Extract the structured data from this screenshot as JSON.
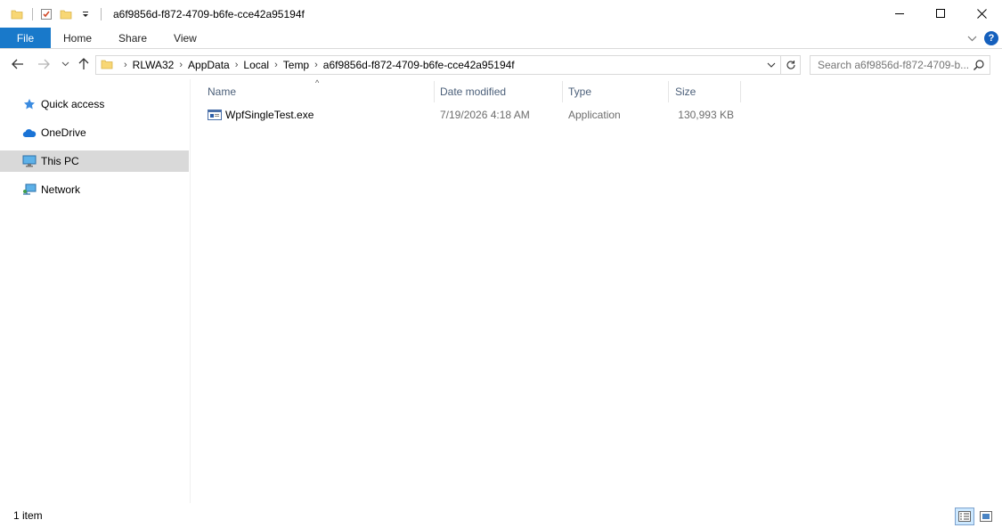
{
  "window": {
    "title": "a6f9856d-f872-4709-b6fe-cce42a95194f",
    "controls": [
      "minimize",
      "maximize",
      "close"
    ]
  },
  "quick_access_toolbar": {
    "icons": [
      "folder-icon",
      "properties-icon",
      "new-folder-icon",
      "customize-dropdown-icon"
    ]
  },
  "ribbon": {
    "tabs": [
      "File",
      "Home",
      "Share",
      "View"
    ],
    "accent": "#1979ca",
    "help_label": "?"
  },
  "navigation": {
    "breadcrumbs": [
      "RLWA32",
      "AppData",
      "Local",
      "Temp",
      "a6f9856d-f872-4709-b6fe-cce42a95194f"
    ],
    "search_placeholder": "Search a6f9856d-f872-4709-b..."
  },
  "sidebar": {
    "items": [
      {
        "label": "Quick access",
        "icon": "star-icon",
        "selected": false
      },
      {
        "label": "OneDrive",
        "icon": "cloud-icon",
        "selected": false
      },
      {
        "label": "This PC",
        "icon": "computer-icon",
        "selected": true
      },
      {
        "label": "Network",
        "icon": "network-icon",
        "selected": false
      }
    ]
  },
  "file_list": {
    "columns": [
      "Name",
      "Date modified",
      "Type",
      "Size"
    ],
    "sorted_by": "Name",
    "rows": [
      {
        "name": "WpfSingleTest.exe",
        "date_modified": "7/19/2026 4:18 AM",
        "type": "Application",
        "size": "130,993 KB",
        "icon": "application-icon"
      }
    ]
  },
  "status_bar": {
    "item_count": "1 item",
    "views": [
      "details-view",
      "large-icons-view"
    ],
    "active_view": "details-view"
  }
}
